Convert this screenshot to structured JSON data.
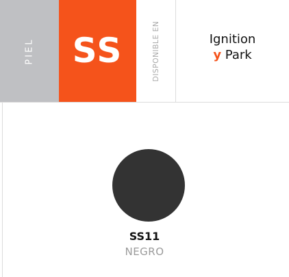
{
  "header": {
    "category_label": "PIEL",
    "code_label": "SS",
    "available_label": "DISPONIBLE EN",
    "available_line1": "Ignition",
    "available_connector": "y",
    "available_line2_rest": " Park"
  },
  "swatch": {
    "code": "SS11",
    "name": "NEGRO",
    "color": "#333333"
  },
  "colors": {
    "accent": "#f5531b",
    "category_bg": "#bfc0c3"
  }
}
